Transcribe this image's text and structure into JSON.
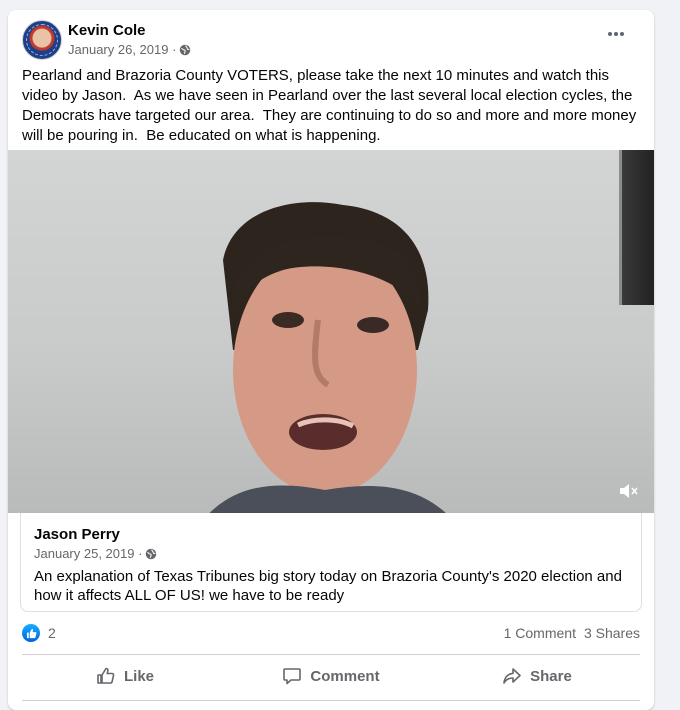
{
  "post": {
    "author": "Kevin Cole",
    "date": "January 26, 2019 ·",
    "privacy_icon": "globe-icon",
    "text": "Pearland and Brazoria County VOTERS, please take the next 10 minutes and watch this video by Jason.  As we have seen in Pearland over the last several local election cycles, the Democrats have targeted our area.  They are continuing to do so and more and more money will be pouring in.  Be educated on what is happening."
  },
  "shared": {
    "author": "Jason Perry",
    "date": "January 25, 2019 ·",
    "privacy_icon": "globe-icon",
    "text": "An explanation of Texas Tribunes big story today on Brazoria County's 2020 election and how it affects ALL OF US! we have to be ready"
  },
  "stats": {
    "likes": "2",
    "comments": "1 Comment",
    "shares": "3 Shares"
  },
  "actions": {
    "like": "Like",
    "comment": "Comment",
    "share": "Share"
  },
  "colors": {
    "accent": "#1877f2",
    "muted_text": "#65676b"
  }
}
